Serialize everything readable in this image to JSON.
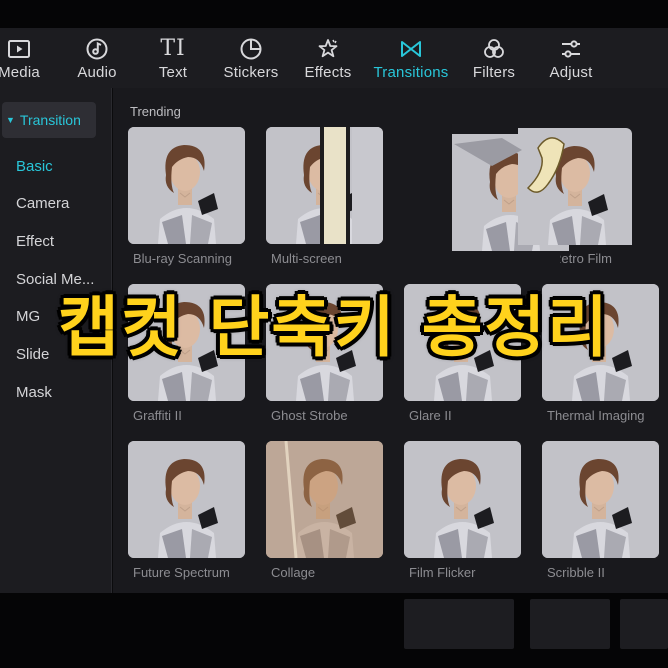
{
  "toolbar": {
    "tabs": [
      {
        "label": "Media",
        "icon": "media-icon"
      },
      {
        "label": "Audio",
        "icon": "audio-icon"
      },
      {
        "label": "Text",
        "icon": "text-icon",
        "glyph": "TI"
      },
      {
        "label": "Stickers",
        "icon": "stickers-icon"
      },
      {
        "label": "Effects",
        "icon": "effects-icon"
      },
      {
        "label": "Transitions",
        "icon": "transitions-icon",
        "active": true
      },
      {
        "label": "Filters",
        "icon": "filters-icon"
      },
      {
        "label": "Adjust",
        "icon": "adjust-icon"
      }
    ],
    "accent_color": "#29c6d9"
  },
  "sidebar": {
    "header": "Transition",
    "items": [
      {
        "label": "Basic",
        "active": true
      },
      {
        "label": "Camera"
      },
      {
        "label": "Effect"
      },
      {
        "label": "Social Me..."
      },
      {
        "label": "MG"
      },
      {
        "label": "Slide"
      },
      {
        "label": "Mask"
      }
    ]
  },
  "main": {
    "section_title": "Trending",
    "cards": [
      {
        "label": "Blu-ray Scanning"
      },
      {
        "label": "Multi-screen"
      },
      {
        "label": "Retro Film"
      },
      {
        "label": "Graffiti II"
      },
      {
        "label": "Ghost Strobe"
      },
      {
        "label": "Glare II"
      },
      {
        "label": "Thermal Imaging"
      },
      {
        "label": "Future Spectrum"
      },
      {
        "label": "Collage"
      },
      {
        "label": "Film Flicker"
      },
      {
        "label": "Scribble II"
      }
    ]
  },
  "banner": {
    "text": "캡컷 단축키 총정리",
    "color": "#ffd21c"
  }
}
